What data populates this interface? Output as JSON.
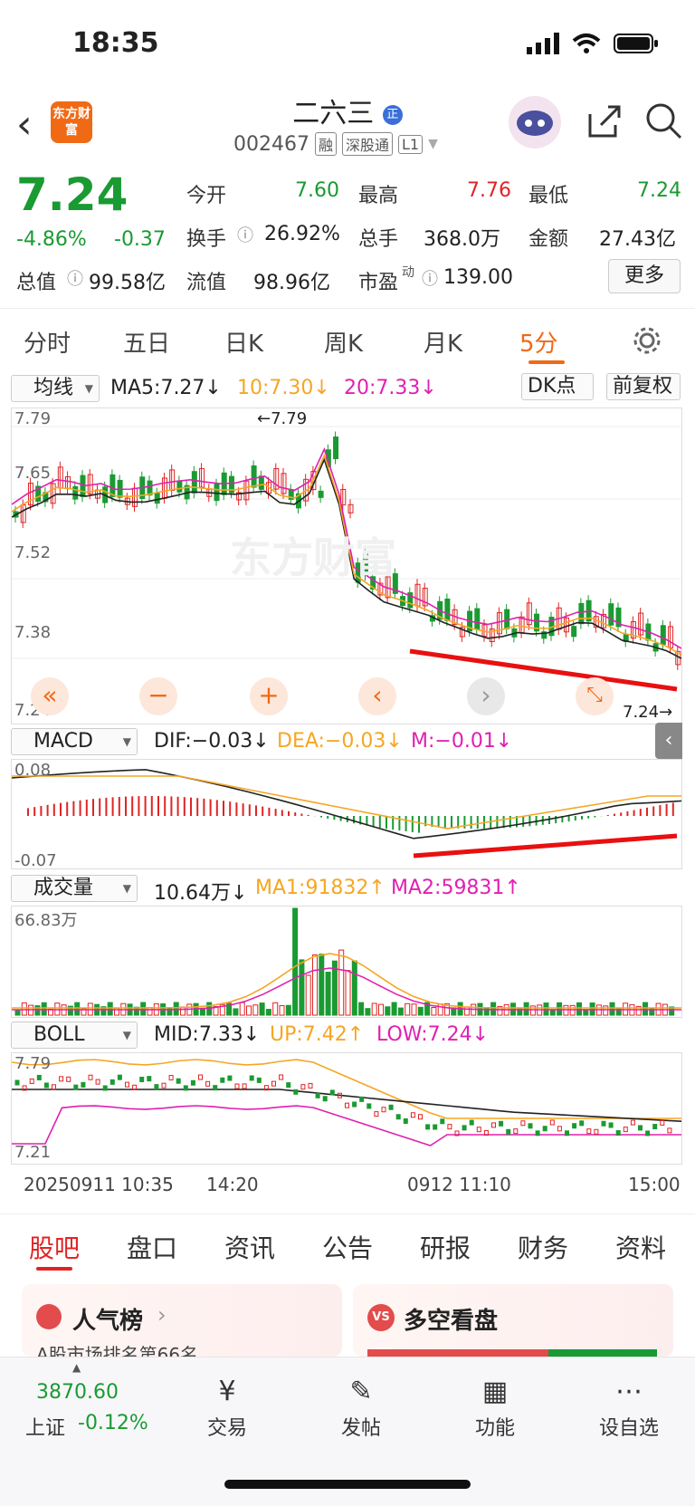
{
  "status": {
    "time": "18:35"
  },
  "header": {
    "logo": "东方财富",
    "name": "二六三",
    "name_badge": "正",
    "code": "002467",
    "tags": [
      "融",
      "深股通",
      "L1"
    ]
  },
  "quote": {
    "price": "7.24",
    "change_pct": "-4.86%",
    "change": "-0.37",
    "rows": [
      [
        {
          "label": "今开",
          "value": "7.60",
          "color": "green"
        },
        {
          "label": "最高",
          "value": "7.76",
          "color": "red"
        },
        {
          "label": "最低",
          "value": "7.24",
          "color": "green"
        }
      ],
      [
        {
          "label": "换手",
          "value": "26.92%"
        },
        {
          "label": "总手",
          "value": "368.0万"
        },
        {
          "label": "金额",
          "value": "27.43亿"
        }
      ],
      [
        {
          "label": "总值",
          "value": "99.58亿"
        },
        {
          "label": "流值",
          "value": "98.96亿"
        },
        {
          "label": "市盈",
          "value": "139.00",
          "sup": "动"
        }
      ]
    ],
    "more": "更多"
  },
  "tabs": [
    "分时",
    "五日",
    "日K",
    "周K",
    "月K",
    "5分"
  ],
  "kline": {
    "selector": "均线",
    "ma5": "MA5:7.27↓",
    "ma10": "10:7.30↓",
    "ma20": "20:7.33↓",
    "dk": "DK点",
    "fq": "前复权",
    "y_labels": [
      "7.79",
      "7.65",
      "7.52",
      "7.38",
      "7.24"
    ],
    "high_label": "←7.79",
    "low_label": "7.24→",
    "watermark": "东方财富"
  },
  "macd": {
    "selector": "MACD",
    "dif": "DIF:−0.03↓",
    "dea": "DEA:−0.03↓",
    "m": "M:−0.01↓",
    "y_top": "0.08",
    "y_bottom": "-0.07"
  },
  "volume": {
    "selector": "成交量",
    "value": "10.64万↓",
    "ma1": "MA1:91832↑",
    "ma2": "MA2:59831↑",
    "y_top": "66.83万"
  },
  "boll": {
    "selector": "BOLL",
    "mid": "MID:7.33↓",
    "up": "UP:7.42↑",
    "low": "LOW:7.24↓",
    "y_top": "7.79",
    "y_bottom": "7.21"
  },
  "x_axis": [
    "20250911 10:35",
    "14:20",
    "0912 11:10",
    "15:00"
  ],
  "bottom_tabs": [
    "股吧",
    "盘口",
    "资讯",
    "公告",
    "研报",
    "财务",
    "资料"
  ],
  "cards": {
    "left": "人气榜",
    "left_sub": "A股市场排名第66名",
    "right": "多空看盘"
  },
  "nav": {
    "index_value": "3870.60",
    "index_name": "上证",
    "index_change": "-0.12%",
    "items": [
      "交易",
      "发帖",
      "功能",
      "设自选"
    ]
  },
  "colors": {
    "up": "#e02424",
    "down": "#1a9a32",
    "accent": "#f06a16",
    "ma10": "#f5a623",
    "ma20": "#e020b0"
  }
}
